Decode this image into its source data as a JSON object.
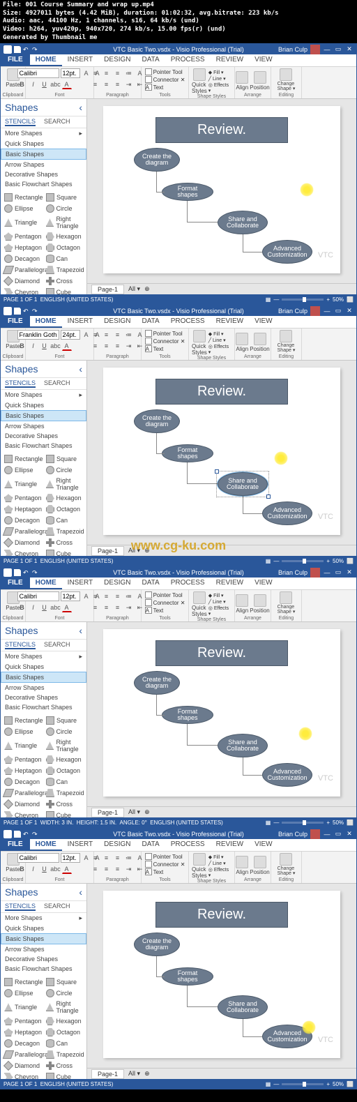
{
  "file_info": {
    "file": "File: 001 Course Summary and wrap up.mp4",
    "size": "Size: 4927011 bytes (4.42 MiB), duration: 01:02:32, avg.bitrate: 223 kb/s",
    "audio": "Audio: aac, 44100 Hz, 1 channels, s16, 64 kb/s (und)",
    "video": "Video: h264, yuv420p, 940x720, 274 kb/s, 15.00 fps(r) (und)",
    "generated": "Generated by Thumbnail me"
  },
  "app": {
    "title": "VTC Basic Two.vsdx - Visio Professional (Trial)",
    "user": "Brian Culp"
  },
  "tabs": {
    "file": "FILE",
    "home": "HOME",
    "insert": "INSERT",
    "design": "DESIGN",
    "data": "DATA",
    "process": "PROCESS",
    "review": "REVIEW",
    "view": "VIEW"
  },
  "ribbon": {
    "paste": "Paste",
    "clipboard": "Clipboard",
    "font_name": "Calibri",
    "font_name2": "Franklin Gothic B",
    "font_size": "12pt.",
    "font_size2": "24pt.",
    "font_label": "Font",
    "paragraph": "Paragraph",
    "pointer": "Pointer Tool",
    "connector": "Connector",
    "text": "Text",
    "tools": "Tools",
    "quick_styles": "Quick Styles",
    "fill": "Fill",
    "line": "Line",
    "effects": "Effects",
    "shape_styles": "Shape Styles",
    "align": "Align",
    "position": "Position",
    "arrange": "Arrange",
    "change_shape": "Change Shape",
    "editing": "Editing"
  },
  "shapes": {
    "header": "Shapes",
    "stencils": "STENCILS",
    "search": "SEARCH",
    "more": "More Shapes",
    "quick": "Quick Shapes",
    "basic": "Basic Shapes",
    "arrow": "Arrow Shapes",
    "decorative": "Decorative Shapes",
    "flowchart": "Basic Flowchart Shapes",
    "items": [
      [
        "Rectangle",
        "Square"
      ],
      [
        "Ellipse",
        "Circle"
      ],
      [
        "Triangle",
        "Right Triangle"
      ],
      [
        "Pentagon",
        "Hexagon"
      ],
      [
        "Heptagon",
        "Octagon"
      ],
      [
        "Decagon",
        "Can"
      ],
      [
        "Parallelogra...",
        "Trapezoid"
      ],
      [
        "Diamond",
        "Cross"
      ],
      [
        "Chevron",
        "Cube"
      ]
    ]
  },
  "canvas": {
    "review": "Review.",
    "ov1": "Create the diagram",
    "ov2": "Format shapes",
    "ov3": "Share and Collaborate",
    "ov4": "Advanced Customization",
    "page_tab": "Page-1",
    "all": "All ▾",
    "wm": "VTC"
  },
  "status": {
    "page": "PAGE 1 OF 1",
    "lang": "ENGLISH (UNITED STATES)",
    "width": "WIDTH: 3 IN.",
    "height": "HEIGHT: 1.5 IN.",
    "angle": "ANGLE: 0°",
    "zoom": "50%"
  },
  "watermark": "www.cg-ku.com"
}
